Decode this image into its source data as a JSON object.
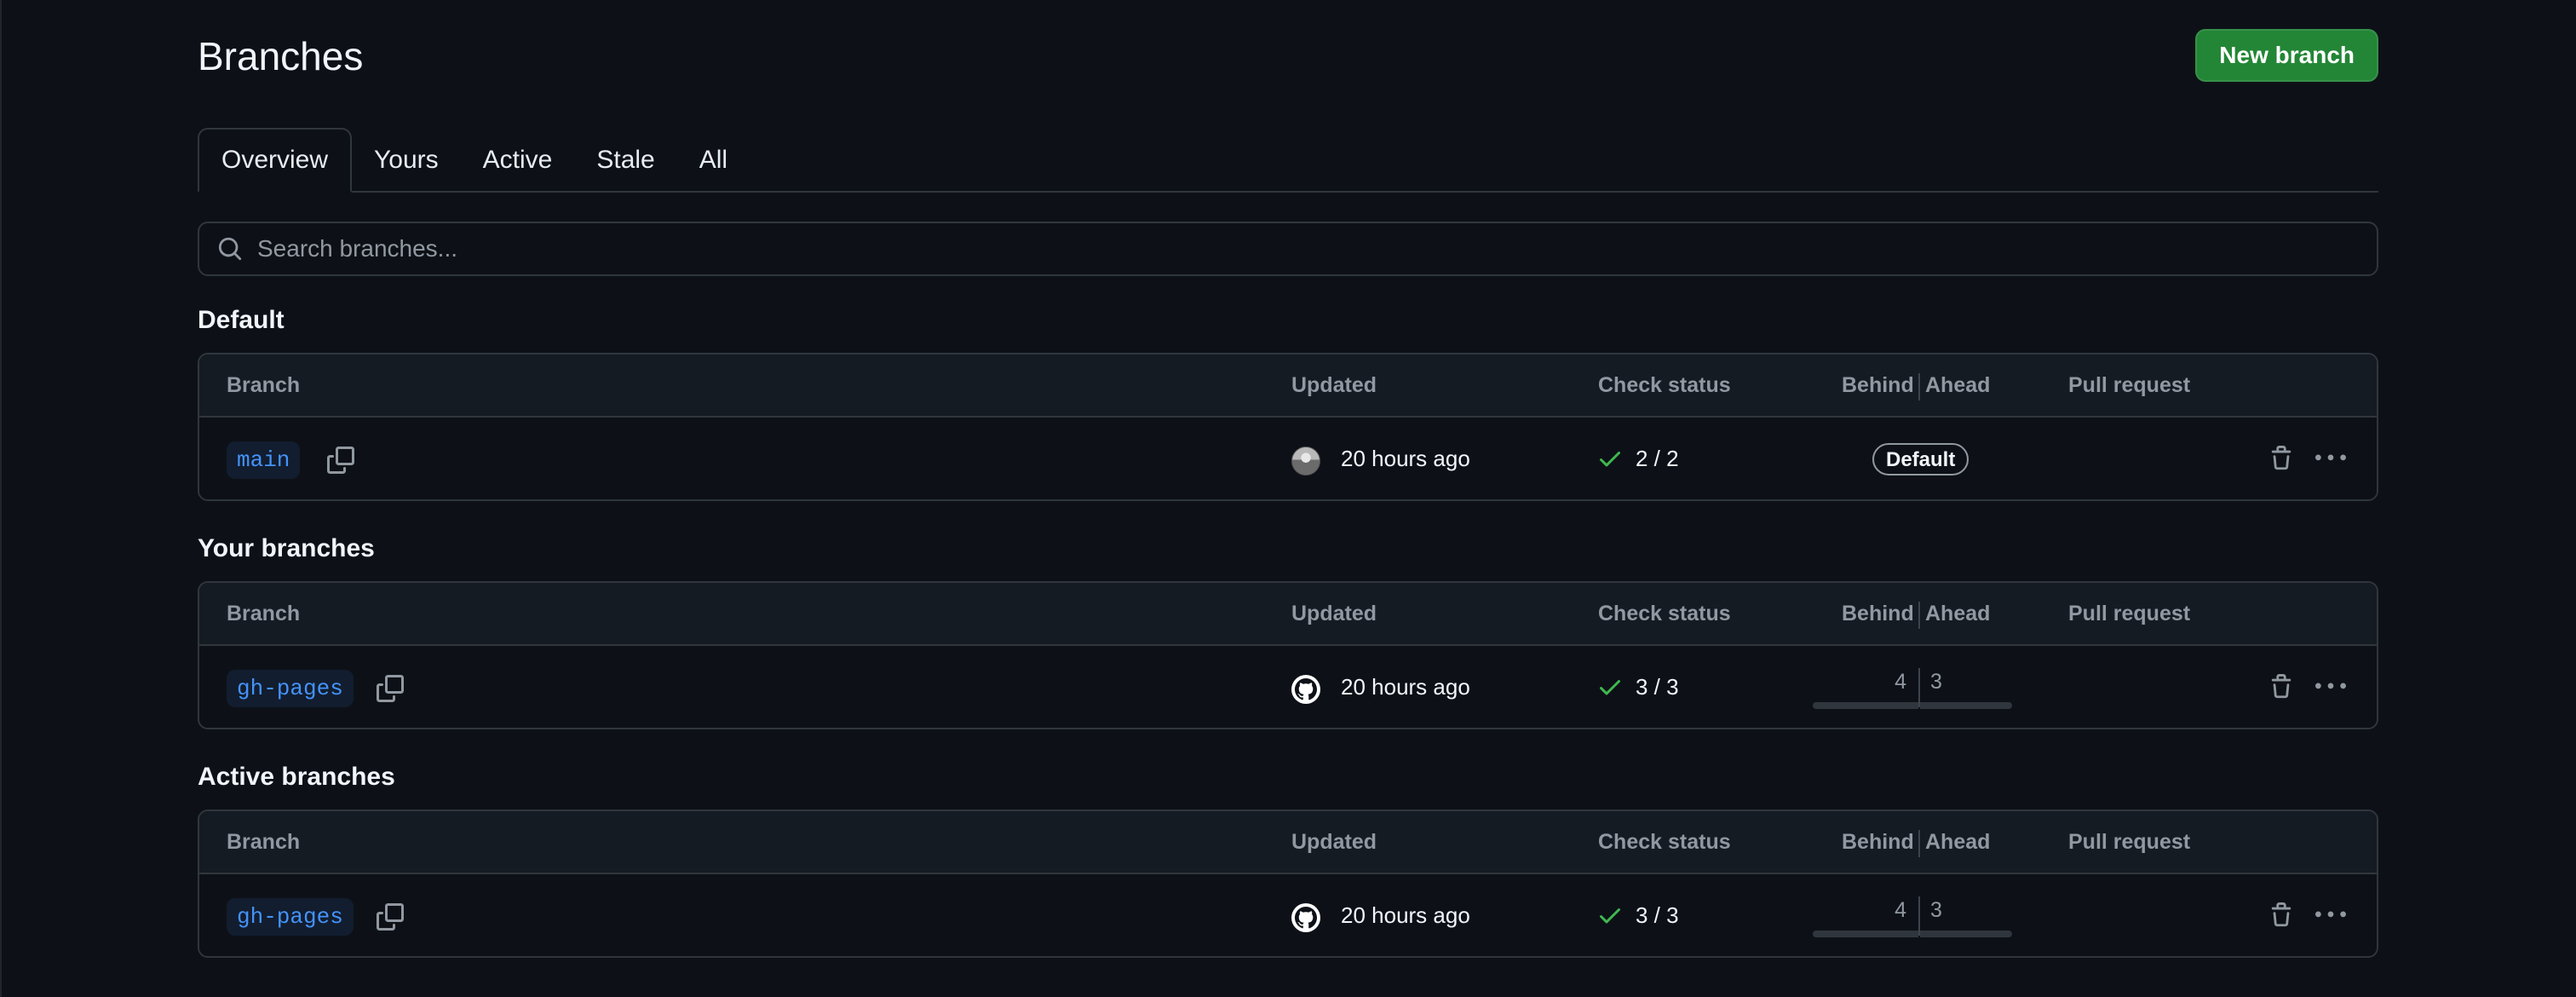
{
  "header": {
    "title": "Branches",
    "new_branch_label": "New branch"
  },
  "tabs": [
    {
      "label": "Overview",
      "selected": true
    },
    {
      "label": "Yours",
      "selected": false
    },
    {
      "label": "Active",
      "selected": false
    },
    {
      "label": "Stale",
      "selected": false
    },
    {
      "label": "All",
      "selected": false
    }
  ],
  "search": {
    "placeholder": "Search branches...",
    "value": ""
  },
  "columns": {
    "branch": "Branch",
    "updated": "Updated",
    "check_status": "Check status",
    "behind": "Behind",
    "ahead": "Ahead",
    "pull_request": "Pull request"
  },
  "sections": [
    {
      "title": "Default",
      "rows": [
        {
          "branch": "main",
          "avatar": "user-photo",
          "updated": "20 hours ago",
          "check_status": "2 / 2",
          "badge": "Default",
          "behind": null,
          "ahead": null
        }
      ]
    },
    {
      "title": "Your branches",
      "rows": [
        {
          "branch": "gh-pages",
          "avatar": "github-icon",
          "updated": "20 hours ago",
          "check_status": "3 / 3",
          "badge": null,
          "behind": "4",
          "ahead": "3"
        }
      ]
    },
    {
      "title": "Active branches",
      "rows": [
        {
          "branch": "gh-pages",
          "avatar": "github-icon",
          "updated": "20 hours ago",
          "check_status": "3 / 3",
          "badge": null,
          "behind": "4",
          "ahead": "3"
        }
      ]
    }
  ],
  "colors": {
    "background": "#0d1117",
    "accent_green": "#238636",
    "link_blue": "#4493f8",
    "success_check": "#3fb950",
    "border": "#30363d"
  },
  "icons": {
    "search": "search-icon",
    "copy": "copy-icon",
    "check": "check-icon",
    "delete": "trash-icon",
    "more": "kebab-horizontal-icon"
  }
}
